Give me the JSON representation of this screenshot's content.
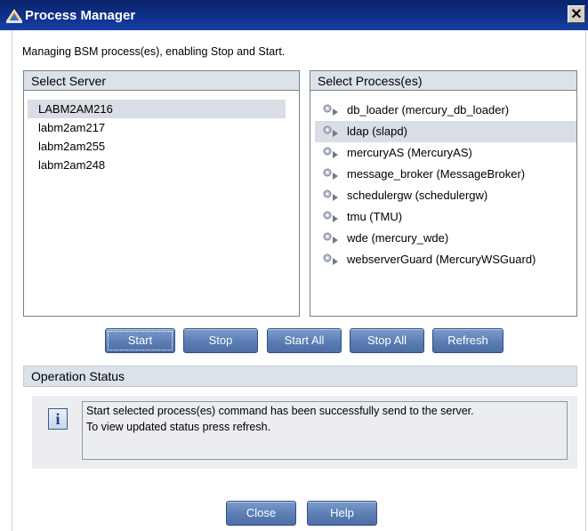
{
  "window": {
    "title": "Process Manager",
    "close_glyph": "✕"
  },
  "subtitle": "Managing BSM process(es), enabling Stop and Start.",
  "server_panel": {
    "header": "Select Server",
    "items": [
      {
        "label": "LABM2AM216",
        "selected": true
      },
      {
        "label": "labm2am217",
        "selected": false
      },
      {
        "label": "labm2am255",
        "selected": false
      },
      {
        "label": "labm2am248",
        "selected": false
      }
    ]
  },
  "process_panel": {
    "header": "Select Process(es)",
    "icon": "gear-process-icon",
    "items": [
      {
        "label": "db_loader (mercury_db_loader)",
        "selected": false
      },
      {
        "label": "ldap (slapd)",
        "selected": true
      },
      {
        "label": "mercuryAS (MercuryAS)",
        "selected": false
      },
      {
        "label": "message_broker (MessageBroker)",
        "selected": false
      },
      {
        "label": "schedulergw (schedulergw)",
        "selected": false
      },
      {
        "label": "tmu (TMU)",
        "selected": false
      },
      {
        "label": "wde (mercury_wde)",
        "selected": false
      },
      {
        "label": "webserverGuard (MercuryWSGuard)",
        "selected": false
      }
    ]
  },
  "actions": {
    "start": "Start",
    "stop": "Stop",
    "start_all": "Start All",
    "stop_all": "Stop All",
    "refresh": "Refresh"
  },
  "status": {
    "header": "Operation Status",
    "icon": "info-icon",
    "icon_glyph": "i",
    "line1": "Start selected process(es) command has been successfully send to the server.",
    "line2": "To view updated status press refresh."
  },
  "footer": {
    "close": "Close",
    "help": "Help"
  },
  "colors": {
    "titlebar": "#0a246a",
    "button": "#5b7db4",
    "panel_header": "#dbe2ea",
    "selection": "#d9dde6"
  }
}
